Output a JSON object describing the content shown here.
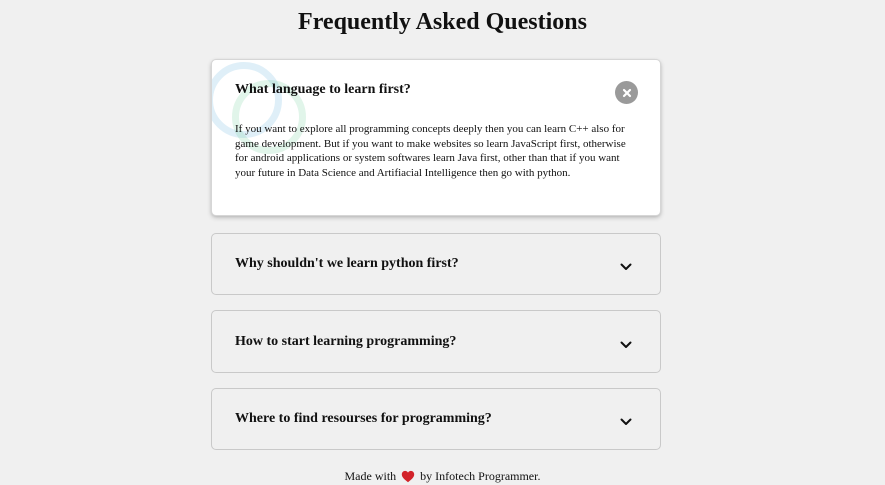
{
  "page": {
    "title": "Frequently Asked Questions"
  },
  "faqs": [
    {
      "question": "What language to learn first?",
      "answer": "If you want to explore all programming concepts deeply then you can learn C++ also for game development. But if you want to make websites so learn JavaScript first, otherwise for android applications or system softwares learn Java first, other than that if you want your future in Data Science and Artifiacial Intelligence then go with python.",
      "expanded": true,
      "toggle_icon": "close-icon"
    },
    {
      "question": "Why shouldn't we learn python first?",
      "expanded": false,
      "toggle_icon": "chevron-down-icon"
    },
    {
      "question": "How to start learning programming?",
      "expanded": false,
      "toggle_icon": "chevron-down-icon"
    },
    {
      "question": "Where to find resourses for programming?",
      "expanded": false,
      "toggle_icon": "chevron-down-icon"
    }
  ],
  "footer": {
    "prefix": "Made with",
    "heart_icon": "heart-icon",
    "suffix": "by Infotech Programmer."
  },
  "colors": {
    "background": "#f0f0f0",
    "active_card": "#ffffff",
    "close_button": "#9a9a9a",
    "heart": "#d2232a"
  }
}
